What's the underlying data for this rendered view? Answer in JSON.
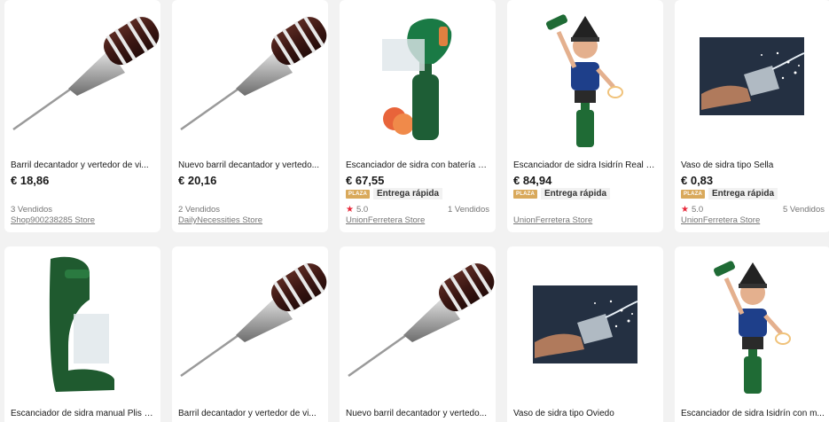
{
  "products": [
    {
      "title": "Barril decantador y vertedor de vi...",
      "price": "€ 18,86",
      "sold": "3 Vendidos",
      "store": "Shop900238285 Store"
    },
    {
      "title": "Nuevo barril decantador y vertedo...",
      "price": "€ 20,16",
      "sold": "2 Vendidos",
      "store": "DailyNecessities Store"
    },
    {
      "title": "Escanciador de sidra con batería d...",
      "price": "€ 67,55",
      "badge": "PLAZA",
      "delivery": "Entrega rápida",
      "rating": "5.0",
      "sold": "1 Vendidos",
      "store": "UnionFerretera Store"
    },
    {
      "title": "Escanciador de sidra Isidrín Real O...",
      "price": "€ 84,94",
      "badge": "PLAZA",
      "delivery": "Entrega rápida",
      "store": "UnionFerretera Store"
    },
    {
      "title": "Vaso de sidra tipo Sella",
      "price": "€ 0,83",
      "badge": "PLAZA",
      "delivery": "Entrega rápida",
      "rating": "5.0",
      "sold": "5 Vendidos",
      "store": "UnionFerretera Store"
    },
    {
      "title": "Escanciador de sidra manual Plis P..."
    },
    {
      "title": "Barril decantador y vertedor de vi..."
    },
    {
      "title": "Nuevo barril decantador y vertedo..."
    },
    {
      "title": "Vaso de sidra tipo Oviedo"
    },
    {
      "title": "Escanciador de sidra Isidrín con m..."
    }
  ],
  "icons": {
    "star": "★",
    "barrel": "barrel-pourer-image",
    "pourer": "cider-pourer-image",
    "figure": "isidrin-figure-image",
    "glass": "cider-glass-image"
  },
  "colors": {
    "background": "#f2f2f2",
    "card": "#ffffff",
    "plaza": "#d9a95b",
    "star": "#e8283a"
  }
}
